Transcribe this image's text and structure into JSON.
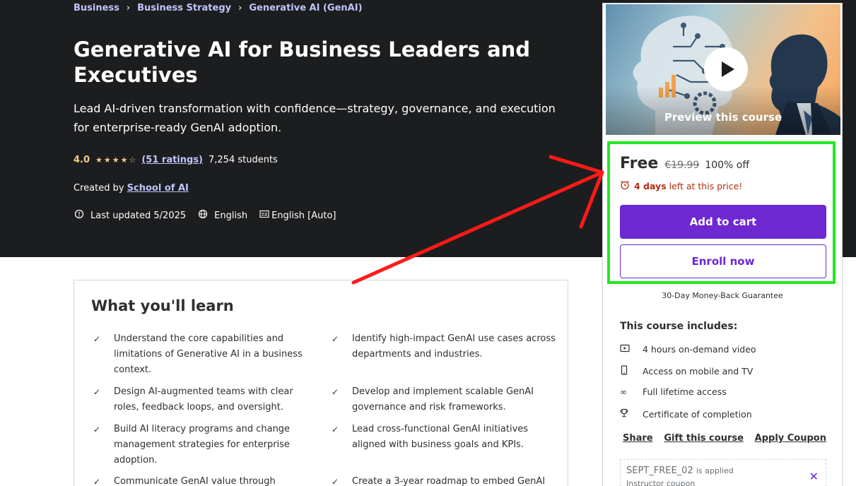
{
  "breadcrumb": [
    "Business",
    "Business Strategy",
    "Generative AI (GenAI)"
  ],
  "course": {
    "title": "Generative AI for Business Leaders and Executives",
    "subtitle": "Lead AI-driven transformation with confidence—strategy, governance, and execution for enterprise-ready GenAI adoption.",
    "rating": "4.0",
    "rating_stars": 4,
    "ratings_link": "(51 ratings)",
    "students": "7,254 students",
    "created_by_label": "Created by",
    "author": "School of AI",
    "last_updated": "Last updated 5/2025",
    "language": "English",
    "captions": "English [Auto]"
  },
  "learn": {
    "title": "What you'll learn",
    "items": [
      "Understand the core capabilities and limitations of Generative AI in a business context.",
      "Identify high-impact GenAI use cases across departments and industries.",
      "Design AI-augmented teams with clear roles, feedback loops, and oversight.",
      "Develop and implement scalable GenAI governance and risk frameworks.",
      "Build AI literacy programs and change management strategies for enterprise adoption.",
      "Lead cross-functional GenAI initiatives aligned with business goals and KPIs.",
      "Communicate GenAI value through",
      "Create a 3-year roadmap to embed GenAI into"
    ]
  },
  "sidebar": {
    "preview_label": "Preview this course",
    "price": "Free",
    "original_price": "€19.99",
    "discount": "100% off",
    "timer_days": "4 days",
    "timer_text": "left at this price!",
    "add_to_cart": "Add to cart",
    "enroll_now": "Enroll now",
    "guarantee": "30-Day Money-Back Guarantee",
    "includes_title": "This course includes:",
    "includes": [
      {
        "icon": "video-icon",
        "text": "4 hours on-demand video"
      },
      {
        "icon": "mobile-icon",
        "text": "Access on mobile and TV"
      },
      {
        "icon": "infinity-icon",
        "text": "Full lifetime access"
      },
      {
        "icon": "trophy-icon",
        "text": "Certificate of completion"
      }
    ],
    "share": "Share",
    "gift": "Gift this course",
    "apply_coupon": "Apply Coupon",
    "coupon_code": "SEPT_FREE_02",
    "coupon_applied": "is applied",
    "coupon_sub": "Instructor coupon"
  },
  "colors": {
    "hero_bg": "#1c1d1f",
    "accent": "#6d28d2",
    "link": "#c0c4fc",
    "star": "#f3ca8c",
    "timer": "#b32d0f",
    "highlight": "#22e822",
    "arrow": "#ff1a1a"
  }
}
